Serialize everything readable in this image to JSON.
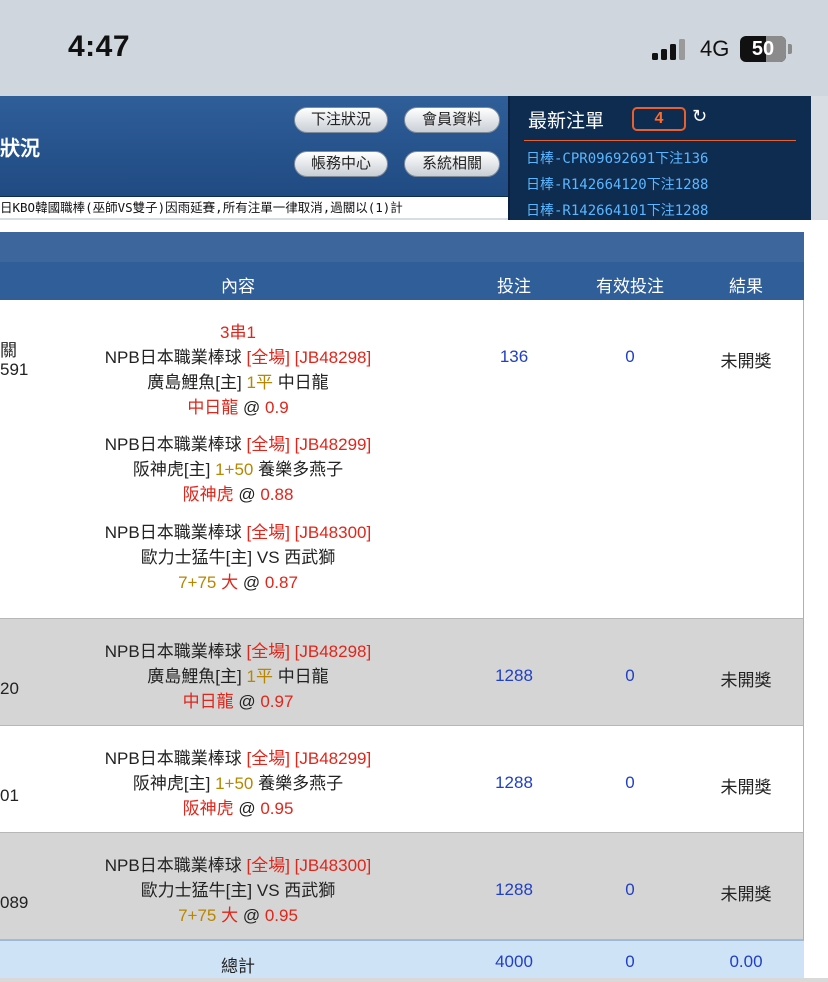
{
  "status_bar": {
    "time": "4:47",
    "network": "4G",
    "battery": "50"
  },
  "header": {
    "title": "狀況",
    "buttons": [
      "下注狀況",
      "會員資料",
      "帳務中心",
      "系統相關"
    ],
    "ticker": "日KBO韓國職棒(巫師VS雙子)因雨延賽,所有注單一律取消,過關以(1)計"
  },
  "latest_bets": {
    "title": "最新注單",
    "count": "4",
    "items": [
      "日棒-CPR09692691下注136",
      "日棒-R142664120下注1288",
      "日棒-R142664101下注1288"
    ]
  },
  "table": {
    "columns": [
      "內容",
      "投注",
      "有效投注",
      "結果"
    ],
    "rows": [
      {
        "left_cut": [
          "關",
          "591"
        ],
        "parlay": "3串1",
        "bets": [
          {
            "league": "NPB日本職業棒球",
            "tag": "[全場] [JB48298]",
            "home": "廣島鯉魚[主]",
            "line": "1平",
            "away": "中日龍",
            "pick": "中日龍",
            "at": "@",
            "odds": "0.9"
          },
          {
            "league": "NPB日本職業棒球",
            "tag": "[全場] [JB48299]",
            "home": "阪神虎[主]",
            "line": "1+50",
            "away": "養樂多燕子",
            "pick": "阪神虎",
            "at": "@",
            "odds": "0.88"
          },
          {
            "league": "NPB日本職業棒球",
            "tag": "[全場] [JB48300]",
            "home": "歐力士猛牛[主]",
            "line": "VS",
            "away": "西武獅",
            "pick_line": "7+75",
            "pick": "大",
            "at": "@",
            "odds": "0.87"
          }
        ],
        "stake": "136",
        "valid": "0",
        "result": "未開獎"
      },
      {
        "left_cut": [
          "20"
        ],
        "bets": [
          {
            "league": "NPB日本職業棒球",
            "tag": "[全場] [JB48298]",
            "home": "廣島鯉魚[主]",
            "line": "1平",
            "away": "中日龍",
            "pick": "中日龍",
            "at": "@",
            "odds": "0.97"
          }
        ],
        "stake": "1288",
        "valid": "0",
        "result": "未開獎"
      },
      {
        "left_cut": [
          "01"
        ],
        "bets": [
          {
            "league": "NPB日本職業棒球",
            "tag": "[全場] [JB48299]",
            "home": "阪神虎[主]",
            "line": "1+50",
            "away": "養樂多燕子",
            "pick": "阪神虎",
            "at": "@",
            "odds": "0.95"
          }
        ],
        "stake": "1288",
        "valid": "0",
        "result": "未開獎"
      },
      {
        "left_cut": [
          "089"
        ],
        "bets": [
          {
            "league": "NPB日本職業棒球",
            "tag": "[全場] [JB48300]",
            "home": "歐力士猛牛[主]",
            "line": "VS",
            "away": "西武獅",
            "pick_line": "7+75",
            "pick": "大",
            "at": "@",
            "odds": "0.95"
          }
        ],
        "stake": "1288",
        "valid": "0",
        "result": "未開獎"
      }
    ],
    "total": {
      "label": "總計",
      "stake": "4000",
      "valid": "0",
      "result": "0.00"
    }
  },
  "colors": {
    "header_blue": "#2f5e99",
    "dark_panel": "#0e2b50",
    "accent_orange": "#e8602c",
    "link_blue": "#5ab7ff",
    "pick_red": "#e0261b",
    "line_gold": "#b88600",
    "number_blue": "#1f3fc7"
  }
}
